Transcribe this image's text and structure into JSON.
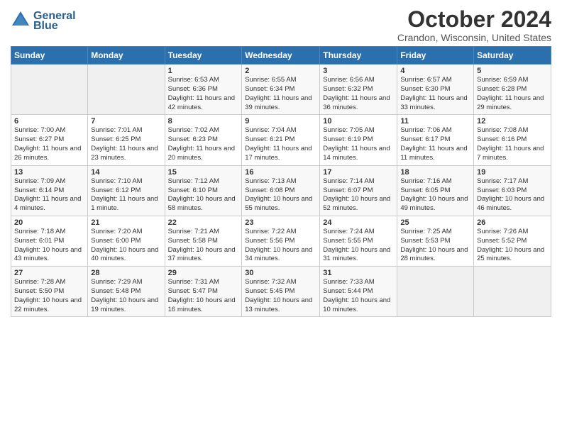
{
  "header": {
    "logo_line1": "General",
    "logo_line2": "Blue",
    "title": "October 2024",
    "location": "Crandon, Wisconsin, United States"
  },
  "weekdays": [
    "Sunday",
    "Monday",
    "Tuesday",
    "Wednesday",
    "Thursday",
    "Friday",
    "Saturday"
  ],
  "weeks": [
    [
      {
        "day": "",
        "text": ""
      },
      {
        "day": "",
        "text": ""
      },
      {
        "day": "1",
        "text": "Sunrise: 6:53 AM\nSunset: 6:36 PM\nDaylight: 11 hours and 42 minutes."
      },
      {
        "day": "2",
        "text": "Sunrise: 6:55 AM\nSunset: 6:34 PM\nDaylight: 11 hours and 39 minutes."
      },
      {
        "day": "3",
        "text": "Sunrise: 6:56 AM\nSunset: 6:32 PM\nDaylight: 11 hours and 36 minutes."
      },
      {
        "day": "4",
        "text": "Sunrise: 6:57 AM\nSunset: 6:30 PM\nDaylight: 11 hours and 33 minutes."
      },
      {
        "day": "5",
        "text": "Sunrise: 6:59 AM\nSunset: 6:28 PM\nDaylight: 11 hours and 29 minutes."
      }
    ],
    [
      {
        "day": "6",
        "text": "Sunrise: 7:00 AM\nSunset: 6:27 PM\nDaylight: 11 hours and 26 minutes."
      },
      {
        "day": "7",
        "text": "Sunrise: 7:01 AM\nSunset: 6:25 PM\nDaylight: 11 hours and 23 minutes."
      },
      {
        "day": "8",
        "text": "Sunrise: 7:02 AM\nSunset: 6:23 PM\nDaylight: 11 hours and 20 minutes."
      },
      {
        "day": "9",
        "text": "Sunrise: 7:04 AM\nSunset: 6:21 PM\nDaylight: 11 hours and 17 minutes."
      },
      {
        "day": "10",
        "text": "Sunrise: 7:05 AM\nSunset: 6:19 PM\nDaylight: 11 hours and 14 minutes."
      },
      {
        "day": "11",
        "text": "Sunrise: 7:06 AM\nSunset: 6:17 PM\nDaylight: 11 hours and 11 minutes."
      },
      {
        "day": "12",
        "text": "Sunrise: 7:08 AM\nSunset: 6:16 PM\nDaylight: 11 hours and 7 minutes."
      }
    ],
    [
      {
        "day": "13",
        "text": "Sunrise: 7:09 AM\nSunset: 6:14 PM\nDaylight: 11 hours and 4 minutes."
      },
      {
        "day": "14",
        "text": "Sunrise: 7:10 AM\nSunset: 6:12 PM\nDaylight: 11 hours and 1 minute."
      },
      {
        "day": "15",
        "text": "Sunrise: 7:12 AM\nSunset: 6:10 PM\nDaylight: 10 hours and 58 minutes."
      },
      {
        "day": "16",
        "text": "Sunrise: 7:13 AM\nSunset: 6:08 PM\nDaylight: 10 hours and 55 minutes."
      },
      {
        "day": "17",
        "text": "Sunrise: 7:14 AM\nSunset: 6:07 PM\nDaylight: 10 hours and 52 minutes."
      },
      {
        "day": "18",
        "text": "Sunrise: 7:16 AM\nSunset: 6:05 PM\nDaylight: 10 hours and 49 minutes."
      },
      {
        "day": "19",
        "text": "Sunrise: 7:17 AM\nSunset: 6:03 PM\nDaylight: 10 hours and 46 minutes."
      }
    ],
    [
      {
        "day": "20",
        "text": "Sunrise: 7:18 AM\nSunset: 6:01 PM\nDaylight: 10 hours and 43 minutes."
      },
      {
        "day": "21",
        "text": "Sunrise: 7:20 AM\nSunset: 6:00 PM\nDaylight: 10 hours and 40 minutes."
      },
      {
        "day": "22",
        "text": "Sunrise: 7:21 AM\nSunset: 5:58 PM\nDaylight: 10 hours and 37 minutes."
      },
      {
        "day": "23",
        "text": "Sunrise: 7:22 AM\nSunset: 5:56 PM\nDaylight: 10 hours and 34 minutes."
      },
      {
        "day": "24",
        "text": "Sunrise: 7:24 AM\nSunset: 5:55 PM\nDaylight: 10 hours and 31 minutes."
      },
      {
        "day": "25",
        "text": "Sunrise: 7:25 AM\nSunset: 5:53 PM\nDaylight: 10 hours and 28 minutes."
      },
      {
        "day": "26",
        "text": "Sunrise: 7:26 AM\nSunset: 5:52 PM\nDaylight: 10 hours and 25 minutes."
      }
    ],
    [
      {
        "day": "27",
        "text": "Sunrise: 7:28 AM\nSunset: 5:50 PM\nDaylight: 10 hours and 22 minutes."
      },
      {
        "day": "28",
        "text": "Sunrise: 7:29 AM\nSunset: 5:48 PM\nDaylight: 10 hours and 19 minutes."
      },
      {
        "day": "29",
        "text": "Sunrise: 7:31 AM\nSunset: 5:47 PM\nDaylight: 10 hours and 16 minutes."
      },
      {
        "day": "30",
        "text": "Sunrise: 7:32 AM\nSunset: 5:45 PM\nDaylight: 10 hours and 13 minutes."
      },
      {
        "day": "31",
        "text": "Sunrise: 7:33 AM\nSunset: 5:44 PM\nDaylight: 10 hours and 10 minutes."
      },
      {
        "day": "",
        "text": ""
      },
      {
        "day": "",
        "text": ""
      }
    ]
  ]
}
